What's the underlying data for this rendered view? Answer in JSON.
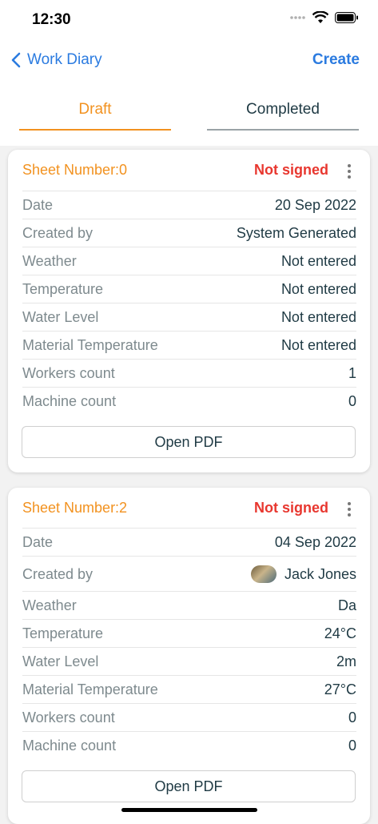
{
  "status_bar": {
    "time": "12:30"
  },
  "nav": {
    "back_label": "Work Diary",
    "create_label": "Create"
  },
  "tabs": [
    {
      "label": "Draft",
      "active": true
    },
    {
      "label": "Completed",
      "active": false
    }
  ],
  "cards": [
    {
      "sheet_number": "Sheet Number:0",
      "status": "Not signed",
      "rows": [
        {
          "label": "Date",
          "value": "20 Sep 2022"
        },
        {
          "label": "Created by",
          "value": "System Generated"
        },
        {
          "label": "Weather",
          "value": "Not entered"
        },
        {
          "label": "Temperature",
          "value": "Not entered"
        },
        {
          "label": "Water Level",
          "value": "Not entered"
        },
        {
          "label": "Material Temperature",
          "value": "Not entered"
        },
        {
          "label": "Workers count",
          "value": "1"
        },
        {
          "label": "Machine count",
          "value": "0"
        }
      ],
      "open_pdf_label": "Open PDF"
    },
    {
      "sheet_number": "Sheet Number:2",
      "status": "Not signed",
      "rows": [
        {
          "label": "Date",
          "value": "04 Sep 2022"
        },
        {
          "label": "Created by",
          "value": "Jack Jones"
        },
        {
          "label": "Weather",
          "value": "Da"
        },
        {
          "label": "Temperature",
          "value": "24°C"
        },
        {
          "label": "Water Level",
          "value": "2m"
        },
        {
          "label": "Material Temperature",
          "value": "27°C"
        },
        {
          "label": "Workers count",
          "value": "0"
        },
        {
          "label": "Machine count",
          "value": "0"
        }
      ],
      "open_pdf_label": "Open PDF"
    }
  ],
  "colors": {
    "accent": "#f29220",
    "link": "#2b7be0",
    "danger": "#e8372f"
  }
}
